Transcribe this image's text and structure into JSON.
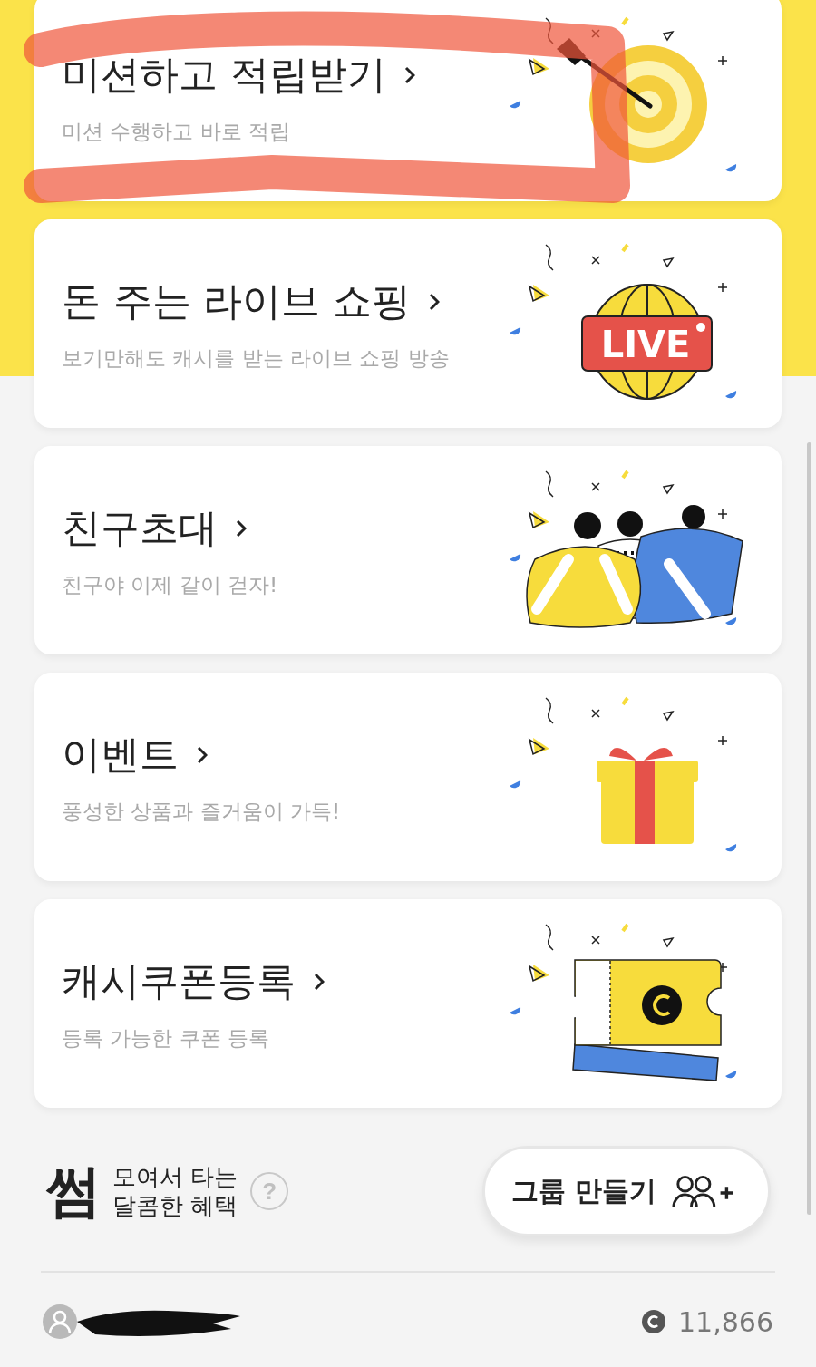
{
  "cards": [
    {
      "kind": "target",
      "title": "미션하고 적립받기",
      "subtitle": "미션 수행하고 바로 적립"
    },
    {
      "kind": "live",
      "title": "돈 주는 라이브 쇼핑",
      "subtitle": "보기만해도 캐시를 받는 라이브 쇼핑 방송",
      "badge": "LIVE"
    },
    {
      "kind": "friends",
      "title": "친구초대",
      "subtitle": "친구야 이제 같이 걷자!"
    },
    {
      "kind": "gift",
      "title": "이벤트",
      "subtitle": "풍성한 상품과 즐거움이 가득!"
    },
    {
      "kind": "coupon",
      "title": "캐시쿠폰등록",
      "subtitle": "등록 가능한 쿠폰 등록"
    }
  ],
  "group": {
    "brand": "썸",
    "tagline": [
      "모여서 타는",
      "달콤한 혜택"
    ],
    "help": "?",
    "button": "그룹 만들기"
  },
  "footer": {
    "balance": "11,866"
  }
}
